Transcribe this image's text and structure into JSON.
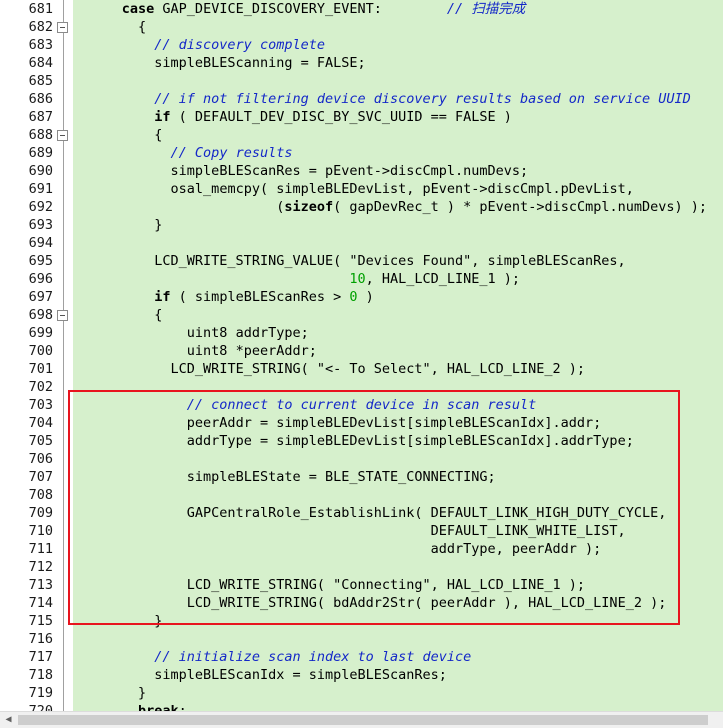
{
  "editor": {
    "lines": [
      {
        "num": "681",
        "fold": false,
        "indent": "      ",
        "parts": [
          {
            "t": "case",
            "c": "kw"
          },
          {
            "t": " GAP_DEVICE_DISCOVERY_EVENT:        "
          },
          {
            "t": "// 扫描完成",
            "c": "cm"
          }
        ]
      },
      {
        "num": "682",
        "fold": true,
        "indent": "        ",
        "parts": [
          {
            "t": "{"
          }
        ]
      },
      {
        "num": "683",
        "fold": false,
        "indent": "          ",
        "parts": [
          {
            "t": "// discovery complete",
            "c": "cm"
          }
        ]
      },
      {
        "num": "684",
        "fold": false,
        "indent": "          ",
        "parts": [
          {
            "t": "simpleBLEScanning = FALSE;"
          }
        ]
      },
      {
        "num": "685",
        "fold": false,
        "indent": "",
        "parts": []
      },
      {
        "num": "686",
        "fold": false,
        "indent": "          ",
        "parts": [
          {
            "t": "// if not filtering device discovery results based on service UUID",
            "c": "cm"
          }
        ]
      },
      {
        "num": "687",
        "fold": false,
        "indent": "          ",
        "parts": [
          {
            "t": "if",
            "c": "kw"
          },
          {
            "t": " ( DEFAULT_DEV_DISC_BY_SVC_UUID == FALSE )"
          }
        ]
      },
      {
        "num": "688",
        "fold": true,
        "indent": "          ",
        "parts": [
          {
            "t": "{"
          }
        ]
      },
      {
        "num": "689",
        "fold": false,
        "indent": "            ",
        "parts": [
          {
            "t": "// Copy results",
            "c": "cm"
          }
        ]
      },
      {
        "num": "690",
        "fold": false,
        "indent": "            ",
        "parts": [
          {
            "t": "simpleBLEScanRes = pEvent->discCmpl.numDevs;"
          }
        ]
      },
      {
        "num": "691",
        "fold": false,
        "indent": "            ",
        "parts": [
          {
            "t": "osal_memcpy( simpleBLEDevList, pEvent->discCmpl.pDevList,"
          }
        ]
      },
      {
        "num": "692",
        "fold": false,
        "indent": "                         ",
        "parts": [
          {
            "t": "("
          },
          {
            "t": "sizeof",
            "c": "kw"
          },
          {
            "t": "( gapDevRec_t ) * pEvent->discCmpl.numDevs) );"
          }
        ]
      },
      {
        "num": "693",
        "fold": false,
        "indent": "          ",
        "parts": [
          {
            "t": "}"
          }
        ]
      },
      {
        "num": "694",
        "fold": false,
        "indent": "",
        "parts": []
      },
      {
        "num": "695",
        "fold": false,
        "indent": "          ",
        "parts": [
          {
            "t": "LCD_WRITE_STRING_VALUE( \"Devices Found\", simpleBLEScanRes,"
          }
        ]
      },
      {
        "num": "696",
        "fold": false,
        "indent": "                                  ",
        "parts": [
          {
            "t": "10",
            "c": "num"
          },
          {
            "t": ", HAL_LCD_LINE_1 );"
          }
        ]
      },
      {
        "num": "697",
        "fold": false,
        "indent": "          ",
        "parts": [
          {
            "t": "if",
            "c": "kw"
          },
          {
            "t": " ( simpleBLEScanRes > "
          },
          {
            "t": "0",
            "c": "num"
          },
          {
            "t": " )"
          }
        ]
      },
      {
        "num": "698",
        "fold": true,
        "indent": "          ",
        "parts": [
          {
            "t": "{"
          }
        ]
      },
      {
        "num": "699",
        "fold": false,
        "indent": "              ",
        "parts": [
          {
            "t": "uint8 addrType;"
          }
        ]
      },
      {
        "num": "700",
        "fold": false,
        "indent": "              ",
        "parts": [
          {
            "t": "uint8 *peerAddr;"
          }
        ]
      },
      {
        "num": "701",
        "fold": false,
        "indent": "            ",
        "parts": [
          {
            "t": "LCD_WRITE_STRING( \"<- To Select\", HAL_LCD_LINE_2 );"
          }
        ]
      },
      {
        "num": "702",
        "fold": false,
        "indent": "",
        "parts": []
      },
      {
        "num": "703",
        "fold": false,
        "indent": "              ",
        "parts": [
          {
            "t": "// connect to current device in scan result",
            "c": "cm"
          }
        ]
      },
      {
        "num": "704",
        "fold": false,
        "indent": "              ",
        "parts": [
          {
            "t": "peerAddr = simpleBLEDevList[simpleBLEScanIdx].addr;"
          }
        ]
      },
      {
        "num": "705",
        "fold": false,
        "indent": "              ",
        "parts": [
          {
            "t": "addrType = simpleBLEDevList[simpleBLEScanIdx].addrType;"
          }
        ]
      },
      {
        "num": "706",
        "fold": false,
        "indent": "",
        "parts": []
      },
      {
        "num": "707",
        "fold": false,
        "indent": "              ",
        "parts": [
          {
            "t": "simpleBLEState = BLE_STATE_CONNECTING;"
          }
        ]
      },
      {
        "num": "708",
        "fold": false,
        "indent": "",
        "parts": []
      },
      {
        "num": "709",
        "fold": false,
        "indent": "              ",
        "parts": [
          {
            "t": "GAPCentralRole_EstablishLink( DEFAULT_LINK_HIGH_DUTY_CYCLE,"
          }
        ]
      },
      {
        "num": "710",
        "fold": false,
        "indent": "                                            ",
        "parts": [
          {
            "t": "DEFAULT_LINK_WHITE_LIST,"
          }
        ]
      },
      {
        "num": "711",
        "fold": false,
        "indent": "                                            ",
        "parts": [
          {
            "t": "addrType, peerAddr );"
          }
        ]
      },
      {
        "num": "712",
        "fold": false,
        "indent": "",
        "parts": []
      },
      {
        "num": "713",
        "fold": false,
        "indent": "              ",
        "parts": [
          {
            "t": "LCD_WRITE_STRING( \"Connecting\", HAL_LCD_LINE_1 );"
          }
        ]
      },
      {
        "num": "714",
        "fold": false,
        "indent": "              ",
        "parts": [
          {
            "t": "LCD_WRITE_STRING( bdAddr2Str( peerAddr ), HAL_LCD_LINE_2 );"
          }
        ]
      },
      {
        "num": "715",
        "fold": false,
        "indent": "          ",
        "parts": [
          {
            "t": "}"
          }
        ]
      },
      {
        "num": "716",
        "fold": false,
        "indent": "",
        "parts": []
      },
      {
        "num": "717",
        "fold": false,
        "indent": "          ",
        "parts": [
          {
            "t": "// initialize scan index to last device",
            "c": "cm"
          }
        ]
      },
      {
        "num": "718",
        "fold": false,
        "indent": "          ",
        "parts": [
          {
            "t": "simpleBLEScanIdx = simpleBLEScanRes;"
          }
        ]
      },
      {
        "num": "719",
        "fold": false,
        "indent": "        ",
        "parts": [
          {
            "t": "}"
          }
        ]
      },
      {
        "num": "720",
        "fold": false,
        "indent": "        ",
        "parts": [
          {
            "t": "break",
            "c": "kw"
          },
          {
            "t": ";"
          }
        ]
      }
    ]
  },
  "colors": {
    "code_background": "#d6f0cc",
    "comment": "#1428c8",
    "number": "#00a000",
    "highlight_box": "#e8141e"
  },
  "icons": {
    "fold_marker": "fold-minus-icon",
    "scroll_left": "scroll-left-arrow-icon"
  },
  "scrollbar": {
    "left_arrow": "◀"
  }
}
